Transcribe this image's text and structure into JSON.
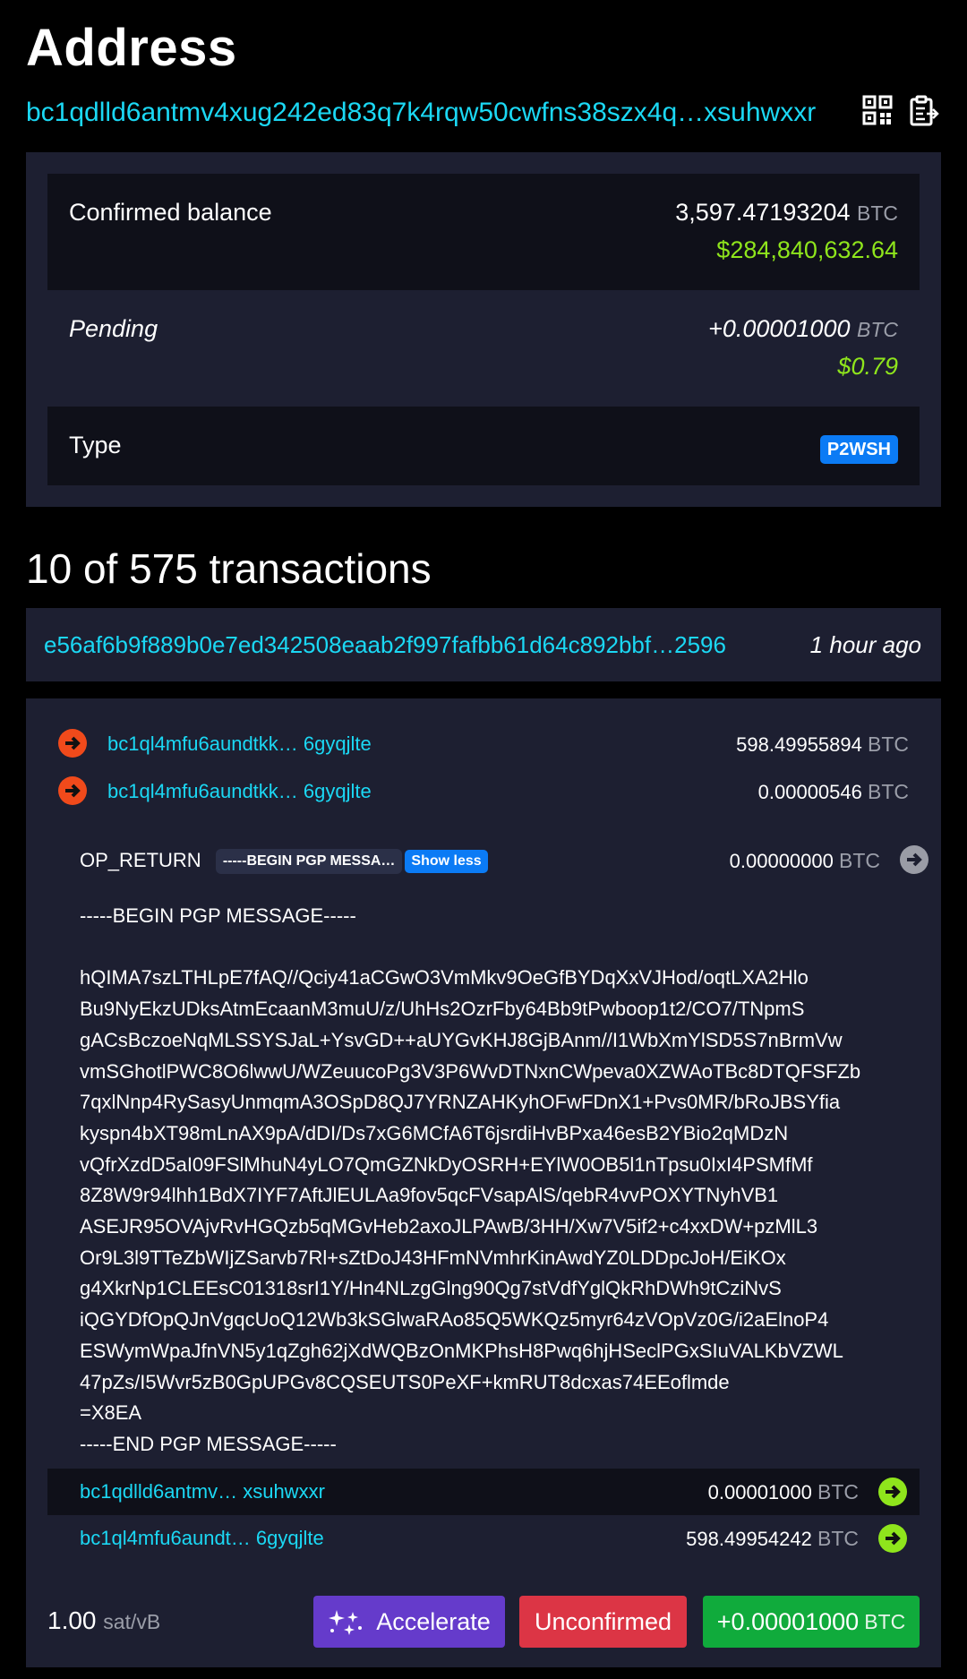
{
  "header": {
    "title": "Address",
    "address": "bc1qdlld6antmv4xug242ed83q7k4rqw50cwfns38szx4q…xsuhwxxr",
    "qr_icon": "qr-code-icon",
    "copy_icon": "clipboard-copy-icon"
  },
  "summary": {
    "confirmed_label": "Confirmed balance",
    "confirmed_btc": "3,597.47193204",
    "confirmed_fiat": "$284,840,632.64",
    "pending_label": "Pending",
    "pending_btc": "+0.00001000",
    "pending_fiat": "$0.79",
    "type_label": "Type",
    "type_value": "P2WSH",
    "unit": "BTC"
  },
  "transactions": {
    "heading": "10 of 575 transactions",
    "txid": "e56af6b9f889b0e7ed342508eaab2f997fafbb61d64c892bbf…2596",
    "time": "1 hour ago",
    "inputs": [
      {
        "address": "bc1ql4mfu6aundtkk… 6gyqjlte",
        "amount": "598.49955894"
      },
      {
        "address": "bc1ql4mfu6aundtkk… 6gyqjlte",
        "amount": "0.00000546"
      }
    ],
    "op_return": {
      "label": "OP_RETURN",
      "chip": "-----BEGIN PGP MESSA…",
      "show_less": "Show less",
      "amount": "0.00000000"
    },
    "pgp_message": "-----BEGIN PGP MESSAGE-----\n\nhQIMA7szLTHLpE7fAQ//Qciy41aCGwO3VmMkv9OeGfBYDqXxVJHod/oqtLXA2Hlo\nBu9NyEkzUDksAtmEcaanM3muU/z/UhHs2OzrFby64Bb9tPwboop1t2/CO7/TNpmS\ngACsBczoeNqMLSSYSJaL+YsvGD++aUYGvKHJ8GjBAnm//I1WbXmYlSD5S7nBrmVw\nvmSGhotlPWC8O6lwwU/WZeuucoPg3V3P6WvDTNxnCWpeva0XZWAoTBc8DTQFSFZb\n7qxlNnp4RySasyUnmqmA3OSpD8QJ7YRNZAHKyhOFwFDnX1+Pvs0MR/bRoJBSYfia\nkyspn4bXT98mLnAX9pA/dDI/Ds7xG6MCfA6T6jsrdiHvBPxa46esB2YBio2qMDzN\nvQfrXzdD5aI09FSlMhuN4yLO7QmGZNkDyOSRH+EYlW0OB5l1nTpsu0IxI4PSMfMf\n8Z8W9r94lhh1BdX7IYF7AftJlEULAa9fov5qcFVsapAlS/qebR4vvPOXYTNyhVB1\nASEJR95OVAjvRvHGQzb5qMGvHeb2axoJLPAwB/3HH/Xw7V5if2+c4xxDW+pzMlL3\nOr9L3l9TTeZbWIjZSarvb7Rl+sZtDoJ43HFmNVmhrKinAwdYZ0LDDpcJoH/EiKOx\ng4XkrNp1CLEEsC01318srI1Y/Hn4NLzgGlng90Qg7stVdfYglQkRhDWh9tCziNvS\niQGYDfOpQJnVgqcUoQ12Wb3kSGlwaRAo85Q5WKQz5myr64zVOpVz0G/i2aElnoP4\nESWymWpaJfnVN5y1qZgh62jXdWQBzOnMKPhsH8Pwq6hjHSeclPGxSIuVALKbVZWL\n47pZs/I5Wvr5zB0GpUPGv8CQSEUTS0PeXF+kmRUT8dcxas74EEoflmde\n=X8EA\n-----END PGP MESSAGE-----",
    "outputs": [
      {
        "address": "bc1qdlld6antmv… xsuhwxxr",
        "amount": "0.00001000"
      },
      {
        "address": "bc1ql4mfu6aundt… 6gyqjlte",
        "amount": "598.49954242"
      }
    ],
    "fee_value": "1.00",
    "fee_unit": "sat/vB",
    "accelerate_label": "Accelerate",
    "status_label": "Unconfirmed",
    "net_amount": "+0.00001000",
    "unit": "BTC"
  },
  "colors": {
    "link": "#1bd8f4",
    "fiat": "#8fe51c",
    "input_arrow": "#f04a1b",
    "output_arrow": "#8fe51c",
    "accelerate": "#653bcb",
    "unconfirmed": "#dc3545",
    "amount_badge": "#10ab3c",
    "type_badge": "#0b7bf5"
  }
}
